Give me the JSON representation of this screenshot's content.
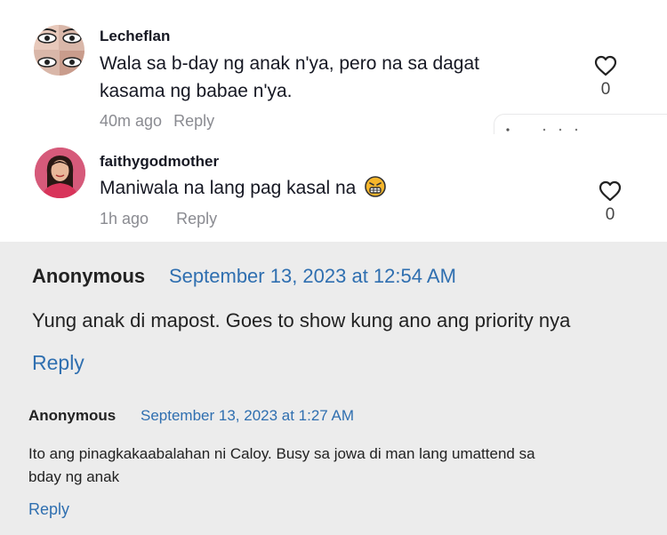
{
  "tiktok_comments": [
    {
      "avatar_icon": "cartoon-eyes-avatar-icon",
      "username": "Lecheflan",
      "text_line1": "Wala sa b-day ng anak n'ya, pero na sa dagat",
      "text_line2": "kasama ng babae n'ya.",
      "time": "40m ago",
      "reply_label": "Reply",
      "like_icon": "heart-outline-icon",
      "like_count": "0"
    },
    {
      "avatar_icon": "woman-profile-photo-avatar-icon",
      "username": "faithygodmother",
      "text": "Maniwala na lang pag kasal na",
      "emoji_icon": "grimacing-face-emoji-icon",
      "time": "1h ago",
      "reply_label": "Reply",
      "like_icon": "heart-outline-icon",
      "like_count": "0"
    }
  ],
  "blog_comments": [
    {
      "author": "Anonymous",
      "date": "September 13, 2023 at 12:54 AM",
      "text": "Yung anak di mapost. Goes to show kung ano ang priority nya",
      "reply_label": "Reply"
    },
    {
      "author": "Anonymous",
      "date": "September 13, 2023 at 1:27 AM",
      "text_line1": "Ito ang pinagkakaabalahan ni Caloy. Busy sa jowa di man lang umattend sa",
      "text_line2": "bday ng anak",
      "reply_label": "Reply"
    }
  ],
  "colors": {
    "tiktok_text": "#161823",
    "tiktok_meta": "#8a8b91",
    "blog_background": "#ececec",
    "blog_link": "#2f6fb0"
  }
}
